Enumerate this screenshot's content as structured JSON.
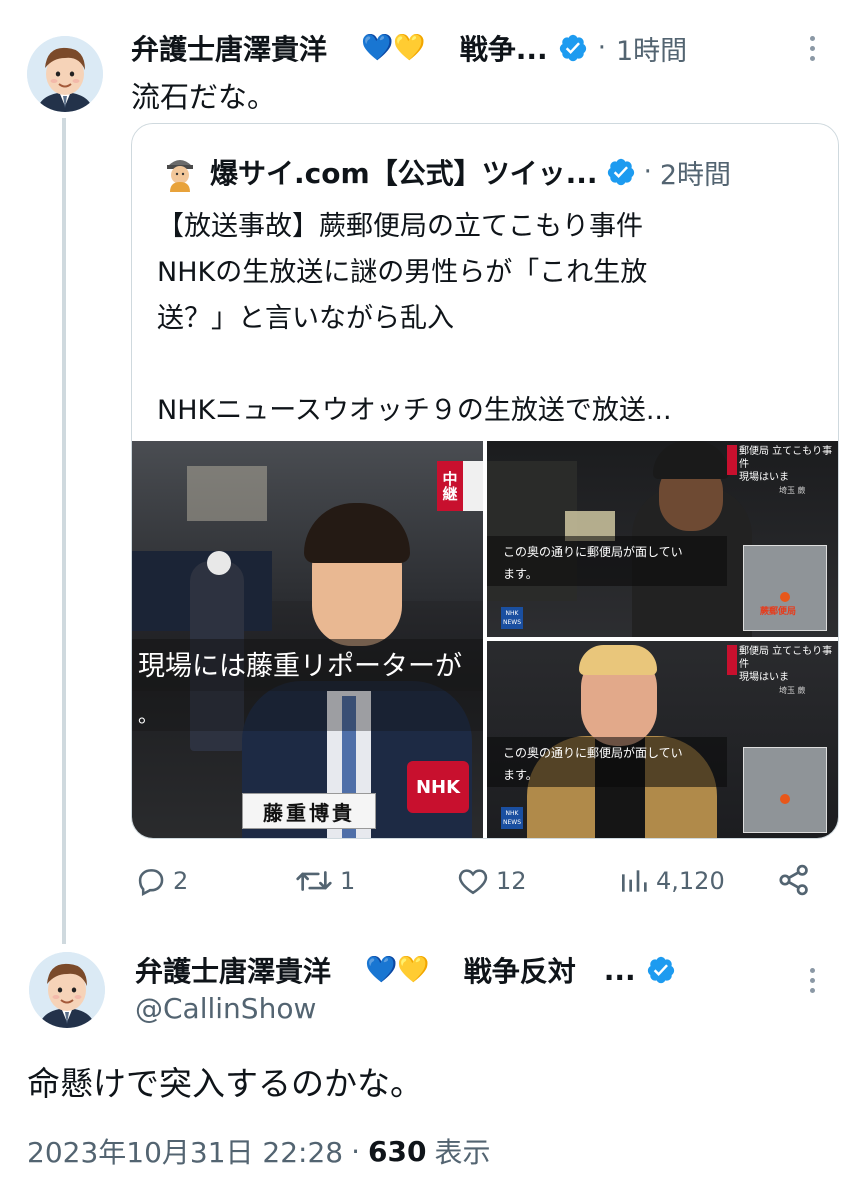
{
  "tweet1": {
    "author_name": "弁護士唐澤貴洋",
    "author_emojis": "💙💛",
    "author_suffix": "戦争...",
    "separator": "·",
    "time": "1時間",
    "text": "流石だな。"
  },
  "quote": {
    "author_name": "爆サイ.com【公式】ツイッ...",
    "separator": "·",
    "time": "2時間",
    "line1": "【放送事故】蕨郵便局の立てこもり事件",
    "line2": "NHKの生放送に謎の男性らが「これ生放",
    "line3": "送？」と言いながら乱入",
    "line4": "NHKニュースウオッチ９の生放送で放送...",
    "media": {
      "left_caption": "現場には藤重リポーターが",
      "left_caption2": "。",
      "left_name": "藤重博貴",
      "live_badge": "中継",
      "armband": "NHK",
      "tr_header": "郵便局 立てこもり事件",
      "tr_header2": "現場はいま",
      "tr_sub": "埼玉 蕨",
      "tr_caption": "この奥の通りに郵便局が面してい",
      "tr_caption2": "ます。",
      "map_label": "蕨郵便局",
      "nhk_logo": "NHK",
      "nhk_logo2": "NEWS",
      "br_header": "郵便局 立てこもり事件",
      "br_header2": "現場はいま",
      "br_sub": "埼玉 蕨",
      "br_caption": "この奥の通りに郵便局が面してい",
      "br_caption2": "ます。"
    }
  },
  "actions": {
    "replies": "2",
    "retweets": "1",
    "likes": "12",
    "views": "4,120"
  },
  "tweet2": {
    "author_name": "弁護士唐澤貴洋",
    "author_emojis": "💙💛",
    "author_suffix": "戦争反対",
    "ellipsis": "...",
    "handle": "@CallinShow",
    "text": "命懸けで突入するのかな。",
    "date": "2023年10月31日 22:28",
    "separator": "·",
    "views_count": "630",
    "views_label": "表示"
  },
  "colors": {
    "verified": "#1d9bf0",
    "muted": "#536471",
    "border": "#cfd9de",
    "nhk_red": "#c8102e"
  }
}
